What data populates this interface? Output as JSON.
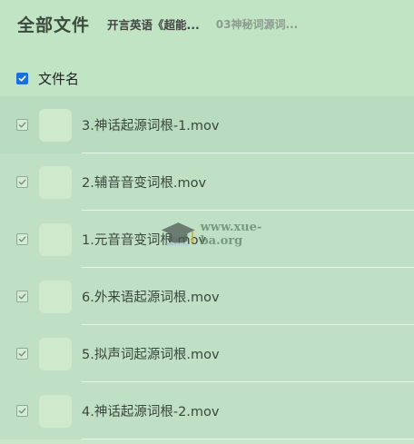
{
  "breadcrumb": {
    "root": "全部文件",
    "level1": "开言英语《超能...",
    "level2": "03神秘词源词..."
  },
  "list_header": {
    "select_all_checked": true,
    "column_title": "文件名"
  },
  "files": [
    {
      "name": "3.神话起源词根-1.mov",
      "checked": true
    },
    {
      "name": "2.辅音音变词根.mov",
      "checked": true
    },
    {
      "name": "1.元音音变词根.mov",
      "checked": true
    },
    {
      "name": "6.外来语起源词根.mov",
      "checked": true
    },
    {
      "name": "5.拟声词起源词根.mov",
      "checked": true
    },
    {
      "name": "4.神话起源词根-2.mov",
      "checked": true
    }
  ],
  "watermark": {
    "text": "www.xue-ba.org",
    "icon": "graduation-cap-icon"
  },
  "colors": {
    "background": "#c1e4c4",
    "accent": "#1a6fd8",
    "thumbnail": "#cfe9cc"
  }
}
